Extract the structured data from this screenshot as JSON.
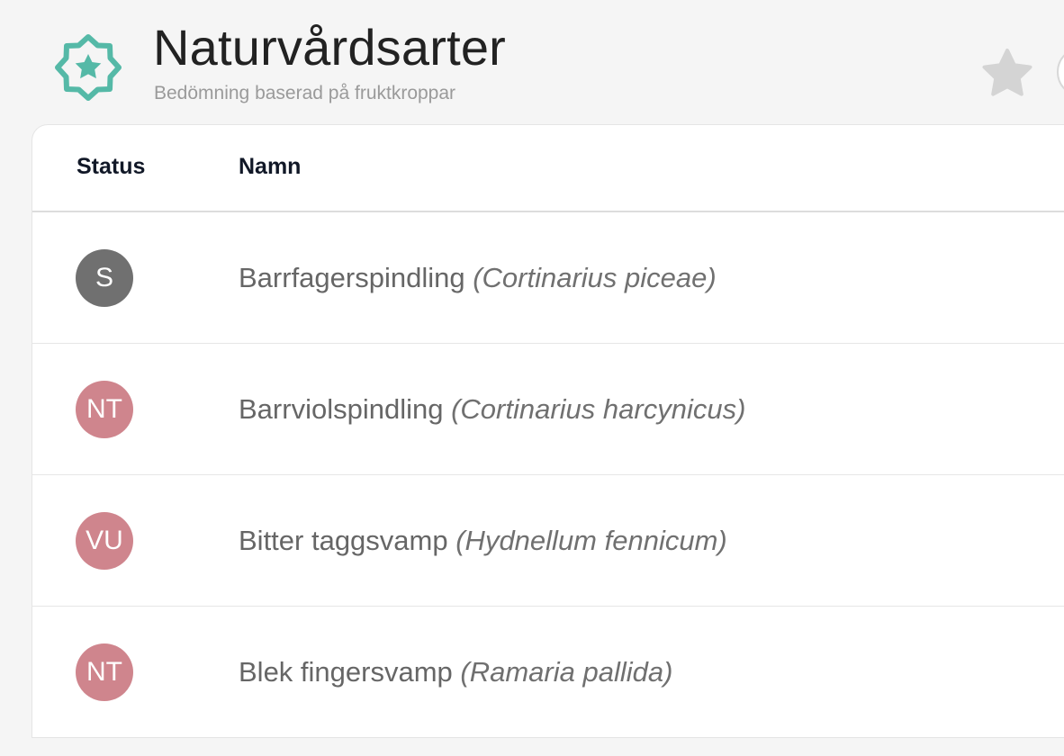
{
  "header": {
    "title": "Naturvårdsarter",
    "subtitle": "Bedömning baserad på fruktkroppar",
    "logo_icon": "star-badge-icon",
    "favorite_icon": "star-icon"
  },
  "colors": {
    "logo_teal": "#55B9A7",
    "star_gray": "#D4D4D4",
    "status_s": "#707070",
    "status_redlist": "#CF858D"
  },
  "table": {
    "headers": {
      "status": "Status",
      "name": "Namn"
    },
    "rows": [
      {
        "status": "S",
        "common_name": "Barrfagerspindling",
        "scientific_name": "(Cortinarius piceae)"
      },
      {
        "status": "NT",
        "common_name": "Barrviolspindling",
        "scientific_name": "(Cortinarius harcynicus)"
      },
      {
        "status": "VU",
        "common_name": "Bitter taggsvamp",
        "scientific_name": "(Hydnellum fennicum)"
      },
      {
        "status": "NT",
        "common_name": "Blek fingersvamp",
        "scientific_name": "(Ramaria pallida)"
      }
    ]
  }
}
